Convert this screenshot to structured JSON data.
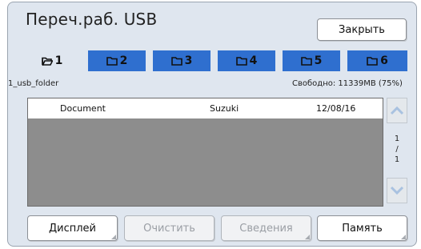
{
  "header": {
    "title": "Переч.раб. USB",
    "close_label": "Закрыть"
  },
  "tabs": [
    {
      "label": "1",
      "active": true
    },
    {
      "label": "2",
      "active": false
    },
    {
      "label": "3",
      "active": false
    },
    {
      "label": "4",
      "active": false
    },
    {
      "label": "5",
      "active": false
    },
    {
      "label": "6",
      "active": false
    }
  ],
  "folder_name": "1_usb_folder",
  "free_space": "Свободно: 11339MB (75%)",
  "files": [
    {
      "name": "Document",
      "owner": "Suzuki",
      "date": "12/08/16"
    }
  ],
  "pagination": {
    "current": "1",
    "separator": "/",
    "total": "1"
  },
  "buttons": {
    "display": "Дисплей",
    "clear": "Очистить",
    "info": "Сведения",
    "memory": "Память"
  },
  "colors": {
    "panel_bg": "#dfe6ef",
    "tab_blue": "#2f6fcf",
    "list_bg": "#8d8d8d",
    "scroll_arrow": "#a9c2e0"
  }
}
